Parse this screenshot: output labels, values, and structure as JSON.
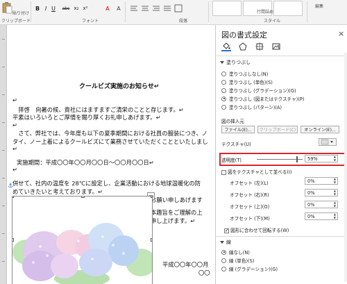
{
  "ribbon": {
    "clipboard_label": "クリップボード",
    "font_label": "フォント",
    "paragraph_label": "段落",
    "style_label": "スタイル",
    "edit_label": "編集",
    "paste_label": "貼り付け",
    "style_boxes": [
      "",
      "",
      ""
    ],
    "font_buttons": [
      "B",
      "I",
      "U",
      "abc",
      "x₂",
      "x²",
      "A",
      "A"
    ],
    "line_spacing_label": "行間詰め"
  },
  "document": {
    "title": "クールビズ実施のお知らせ↵",
    "lines": [
      "↵",
      "　拝啓　向暑の候、貴社にはますますご清栄のことと存じます。↵",
      "平素はいろいろとご厚情を賜り厚くお礼申しあげます。↵",
      "↵",
      "　さて、弊社では、今年度も以下の夏季期間における社員の服装につき、ノ",
      "タイ、ノー上着によるクールビズにて業務させていただくことといたしまし",
      "↵",
      "実施期間：平成〇〇年〇〇月〇〇日～〇〇月〇〇日↵",
      "↵",
      "併せて、社内の温度を 28℃に設定し、企業活動における地球温暖化の防",
      "めていきたいと考えております。↵",
      "弊社にお越しの際には、軽装にてご来社されますようお願い申しあげます",
      "何かとご面倒をおかけすることと存じますが、何卒、本趣旨をご理解の上",
      "続きご支援お引き立てを賜りますよう、宜しくお願い申し上げます。↵",
      "↵",
      "平成〇〇年〇〇月",
      "〇〇"
    ]
  },
  "pane": {
    "title": "図の書式設定",
    "close": "×",
    "fill_header": "塗りつぶし",
    "radios": [
      {
        "label": "塗りつぶしなし(N)",
        "on": false
      },
      {
        "label": "塗りつぶし (単色)(S)",
        "on": false
      },
      {
        "label": "塗りつぶし (グラデーション)(G)",
        "on": false
      },
      {
        "label": "塗りつぶし (図またはテクスチャ)(P)",
        "on": true
      },
      {
        "label": "塗りつぶし (パターン)(A)",
        "on": false
      }
    ],
    "insert_label": "図の挿入元",
    "file_btn": "ファイル(E)...",
    "clipboard_btn": "クリップボード(C)",
    "online_btn": "オンライン(E)...",
    "texture_label": "テクスチャ(U)",
    "transparency_label": "透明度(T)",
    "transparency_value": "59%",
    "tile_label": "図をテクスチャとして並べる(I)",
    "offsets": [
      {
        "label": "オフセット (左)(L)",
        "value": "0%"
      },
      {
        "label": "オフセット (右)(R)",
        "value": "0%"
      },
      {
        "label": "オフセット (上)(O)",
        "value": "0%"
      },
      {
        "label": "オフセット (下)(M)",
        "value": "0%"
      }
    ],
    "rotate_label": "図形に合わせて回転する(W)",
    "line_header": "線",
    "line_radios": [
      {
        "label": "線なし(N)",
        "on": true
      },
      {
        "label": "線 (単色)(S)",
        "on": false
      },
      {
        "label": "線 (グラデーション)(G)",
        "on": false
      }
    ]
  },
  "colors": {
    "highlight": "#d7262a",
    "accent": "#2a6bd6"
  }
}
